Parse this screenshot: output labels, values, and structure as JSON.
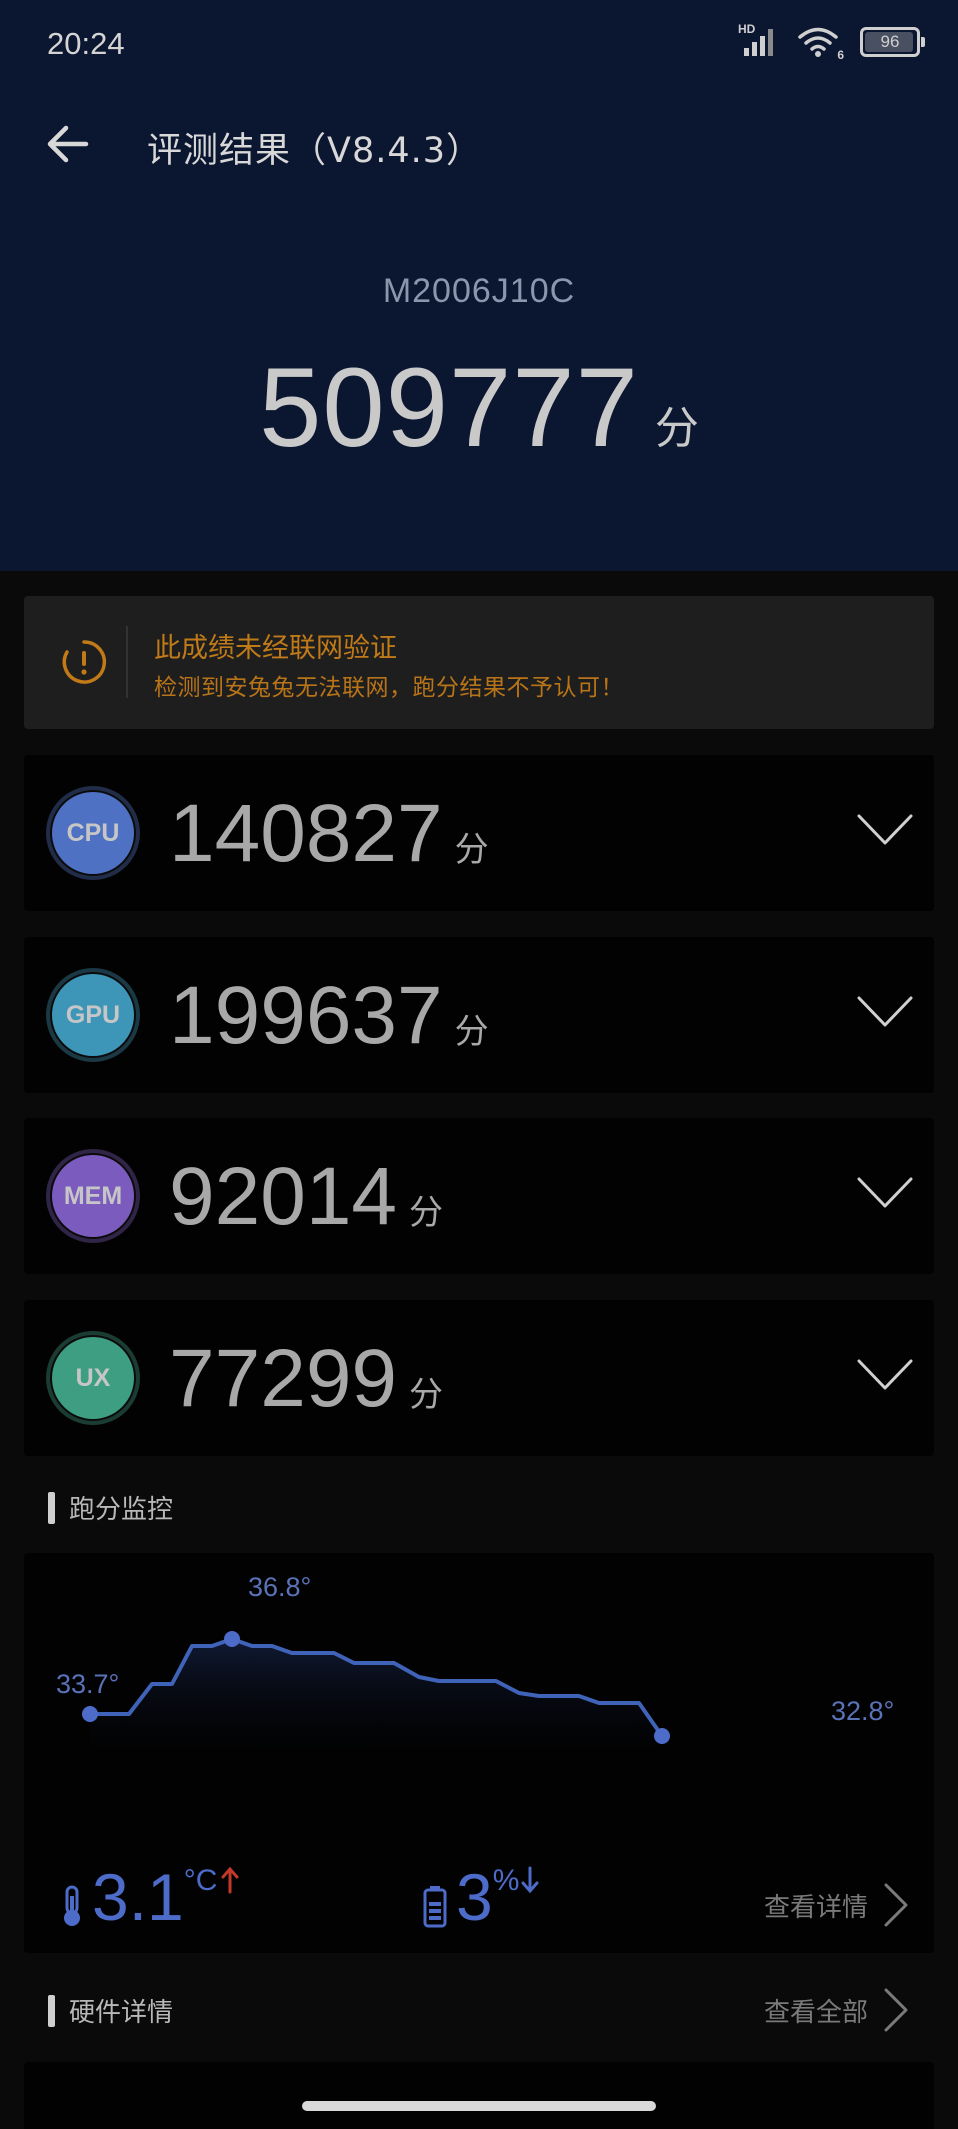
{
  "status_bar": {
    "time": "20:24",
    "network_badge": "HD",
    "wifi_badge": "6",
    "battery_level": "96",
    "battery_fraction": 0.96
  },
  "header": {
    "title": "评测结果（V8.4.3）",
    "back_icon": "arrow-left-icon"
  },
  "device": {
    "model": "M2006J10C",
    "total_score": "509777",
    "score_unit": "分"
  },
  "warning": {
    "icon": "alert-circle-icon",
    "title": "此成绩未经联网验证",
    "subtitle": "检测到安兔兔无法联网，跑分结果不予认可！",
    "color": "#c07a18"
  },
  "scores": [
    {
      "label": "CPU",
      "value": "140827",
      "unit": "分",
      "color": "#4f71c4"
    },
    {
      "label": "GPU",
      "value": "199637",
      "unit": "分",
      "color": "#3d96b8"
    },
    {
      "label": "MEM",
      "value": "92014",
      "unit": "分",
      "color": "#7b5bbd"
    },
    {
      "label": "UX",
      "value": "77299",
      "unit": "分",
      "color": "#3d9e82"
    }
  ],
  "monitor": {
    "section_title": "跑分监控",
    "temp_start": "33.7°",
    "temp_peak": "36.8°",
    "temp_end": "32.8°",
    "temp_rise_value": "3.1",
    "temp_rise_unit": "°C",
    "temp_rise_direction": "up",
    "battery_drop_value": "3",
    "battery_drop_unit": "%",
    "battery_drop_direction": "down",
    "detail_link": "查看详情",
    "line_color": "#3f63b8"
  },
  "hardware": {
    "section_title": "硬件详情",
    "all_link": "查看全部"
  }
}
